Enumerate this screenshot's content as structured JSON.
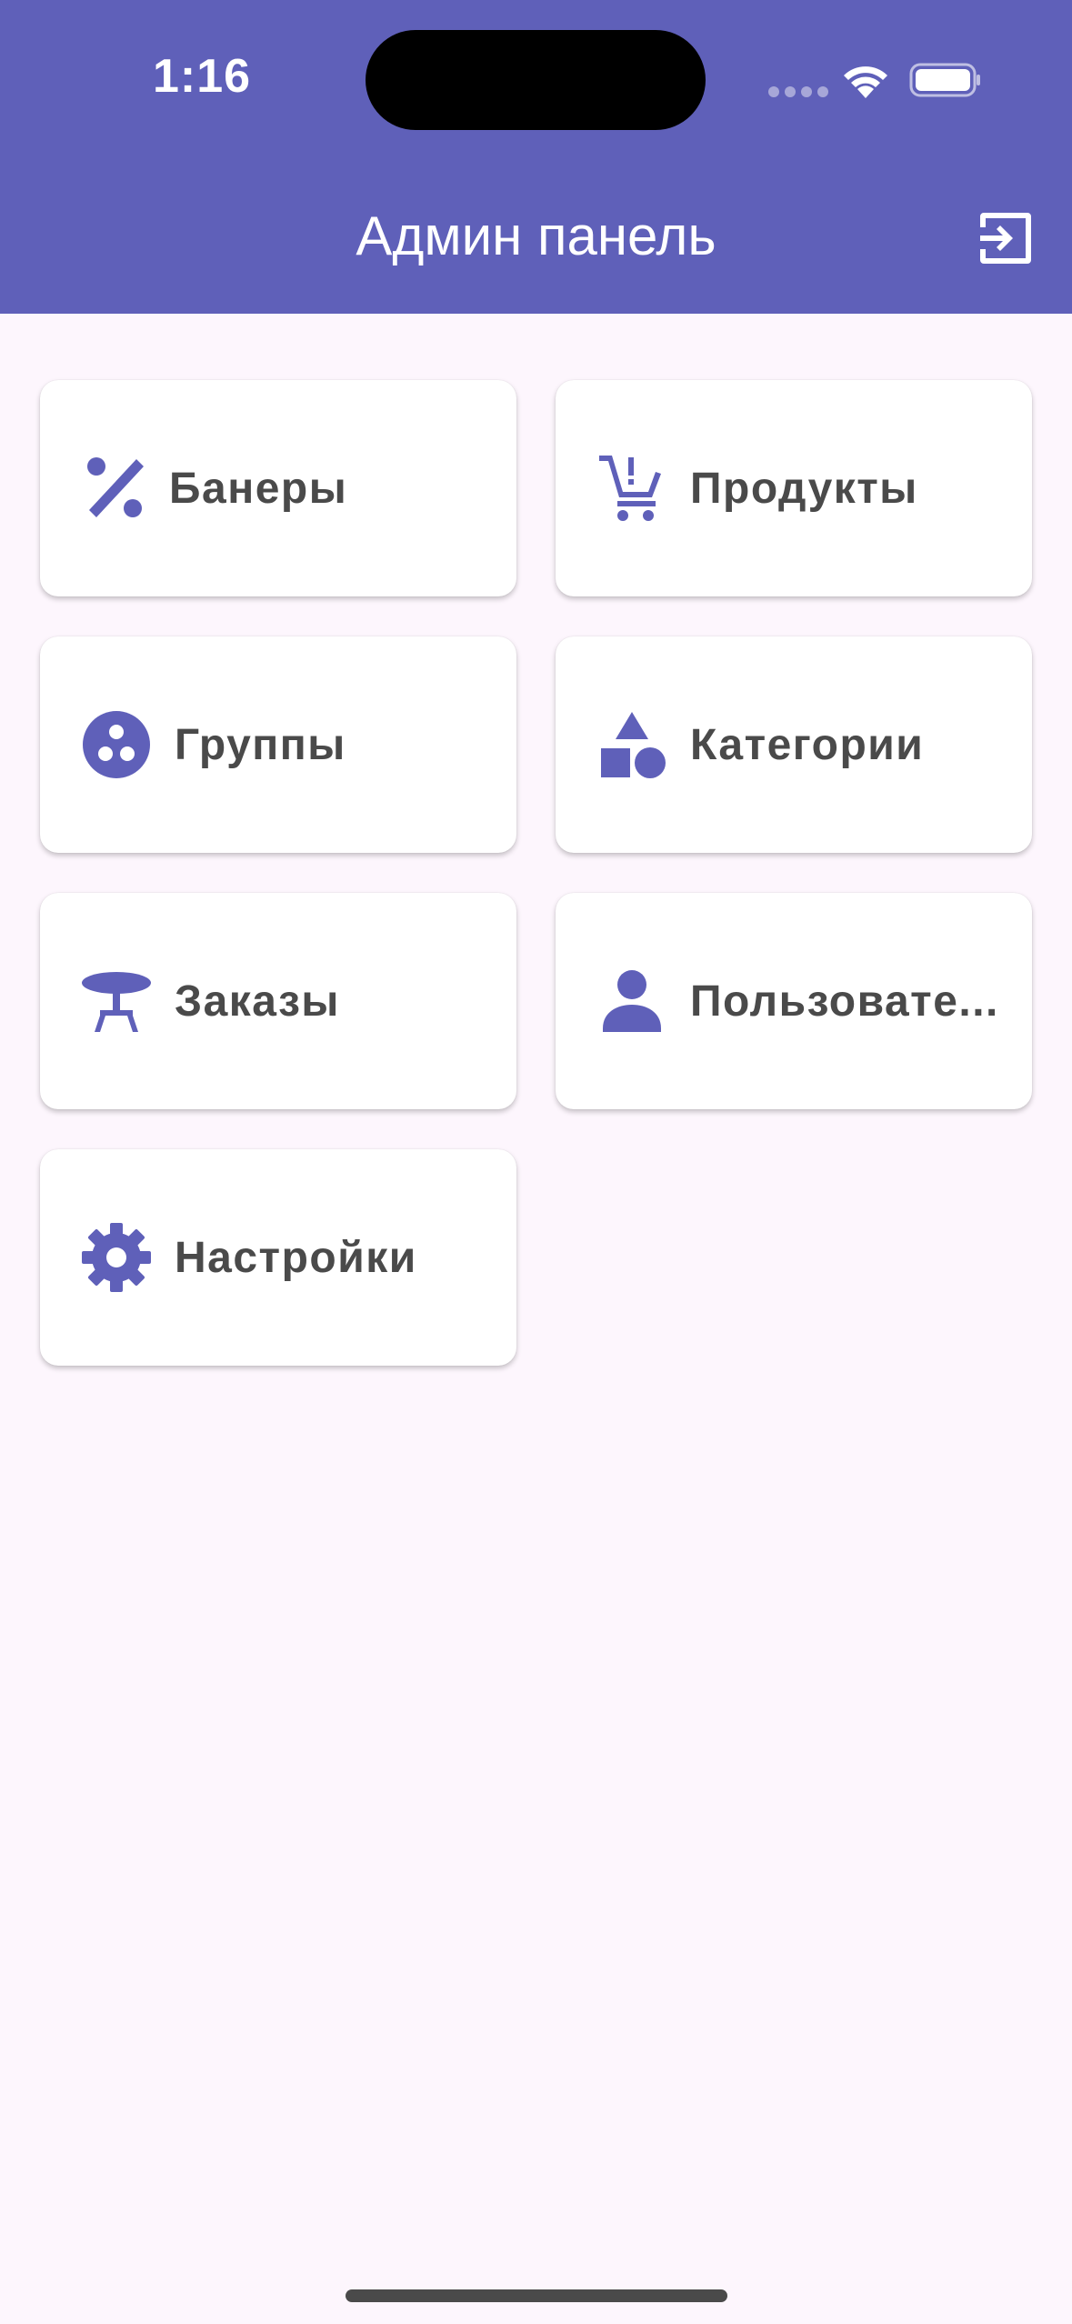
{
  "status_bar": {
    "time": "1:16"
  },
  "appbar": {
    "title": "Админ панель",
    "background_color": "#5f60b9",
    "logout_icon": "logout-icon"
  },
  "tiles": [
    {
      "label": "Банеры",
      "icon": "percent-icon"
    },
    {
      "label": "Продукты",
      "icon": "cart-add-icon"
    },
    {
      "label": "Группы",
      "icon": "workspaces-icon"
    },
    {
      "label": "Категории",
      "icon": "category-shapes-icon"
    },
    {
      "label": "Заказы",
      "icon": "table-icon"
    },
    {
      "label": "Пользовате...",
      "icon": "person-icon"
    },
    {
      "label": "Настройки",
      "icon": "gear-icon"
    }
  ],
  "colors": {
    "accent": "#5f60b9",
    "page_background": "#fdf6fd",
    "tile_text": "#4a4a4a"
  }
}
